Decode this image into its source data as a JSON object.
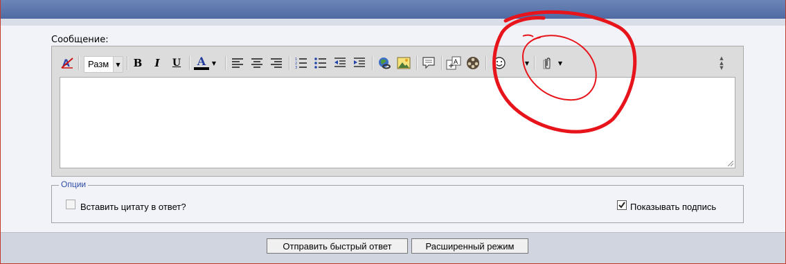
{
  "message_label": "Сообщение:",
  "toolbar": {
    "size_select": "Разм",
    "bold": "B",
    "italic": "I",
    "underline": "U",
    "font_color": "A"
  },
  "options": {
    "legend": "Опции",
    "quote_label": "Вставить цитату в ответ?",
    "quote_checked": false,
    "signature_label": "Показывать подпись",
    "signature_checked": true
  },
  "buttons": {
    "quick_reply": "Отправить быстрый ответ",
    "advanced": "Расширенный режим"
  },
  "colors": {
    "header": "#5a74ab",
    "annotation": "#e8141c"
  }
}
